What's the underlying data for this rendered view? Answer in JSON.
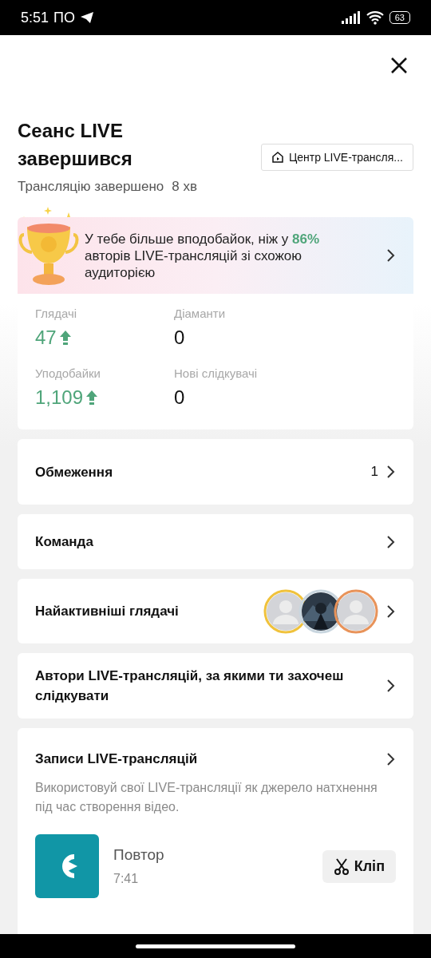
{
  "status_bar": {
    "time": "5:51",
    "day": "ПО",
    "battery": "63"
  },
  "header": {
    "title": "Сеанс LIVE завершився",
    "subtitle": "Трансляцію завершено",
    "duration": "8 хв",
    "center_button": "Центр LIVE-трансля..."
  },
  "highlight": {
    "text": "У тебе більше вподобайок, ніж у **86%** авторів LIVE-трансляцій зі схожою аудиторією"
  },
  "stats": [
    {
      "label": "Глядачі",
      "value": "47",
      "rising": true
    },
    {
      "label": "Діаманти",
      "value": "0",
      "rising": false
    },
    {
      "label": "Уподобайки",
      "value": "1,109",
      "rising": true
    },
    {
      "label": "Нові слідкувачі",
      "value": "0",
      "rising": false
    }
  ],
  "rows": [
    {
      "kind": "count",
      "title": "Обмеження",
      "count": "1"
    },
    {
      "kind": "plain",
      "title": "Команда"
    },
    {
      "kind": "avatars",
      "title": "Найактивніші глядачі",
      "avatars": [
        {
          "kind": "placeholder",
          "color": "#f0c23c"
        },
        {
          "kind": "picture",
          "color": "#c9d6df"
        },
        {
          "kind": "placeholder",
          "color": "#e8935a"
        }
      ]
    },
    {
      "kind": "plain",
      "title": "Автори LIVE-трансляцій, за якими ти захочеш слідкувати"
    }
  ],
  "recordings": {
    "title": "Записи LIVE-трансляцій",
    "description": "Використовуй свої LIVE-трансляції як джерело натхнення під час створення відео.",
    "item": {
      "name": "Повтор",
      "length": "7:41",
      "clip_button": "Кліп"
    }
  }
}
